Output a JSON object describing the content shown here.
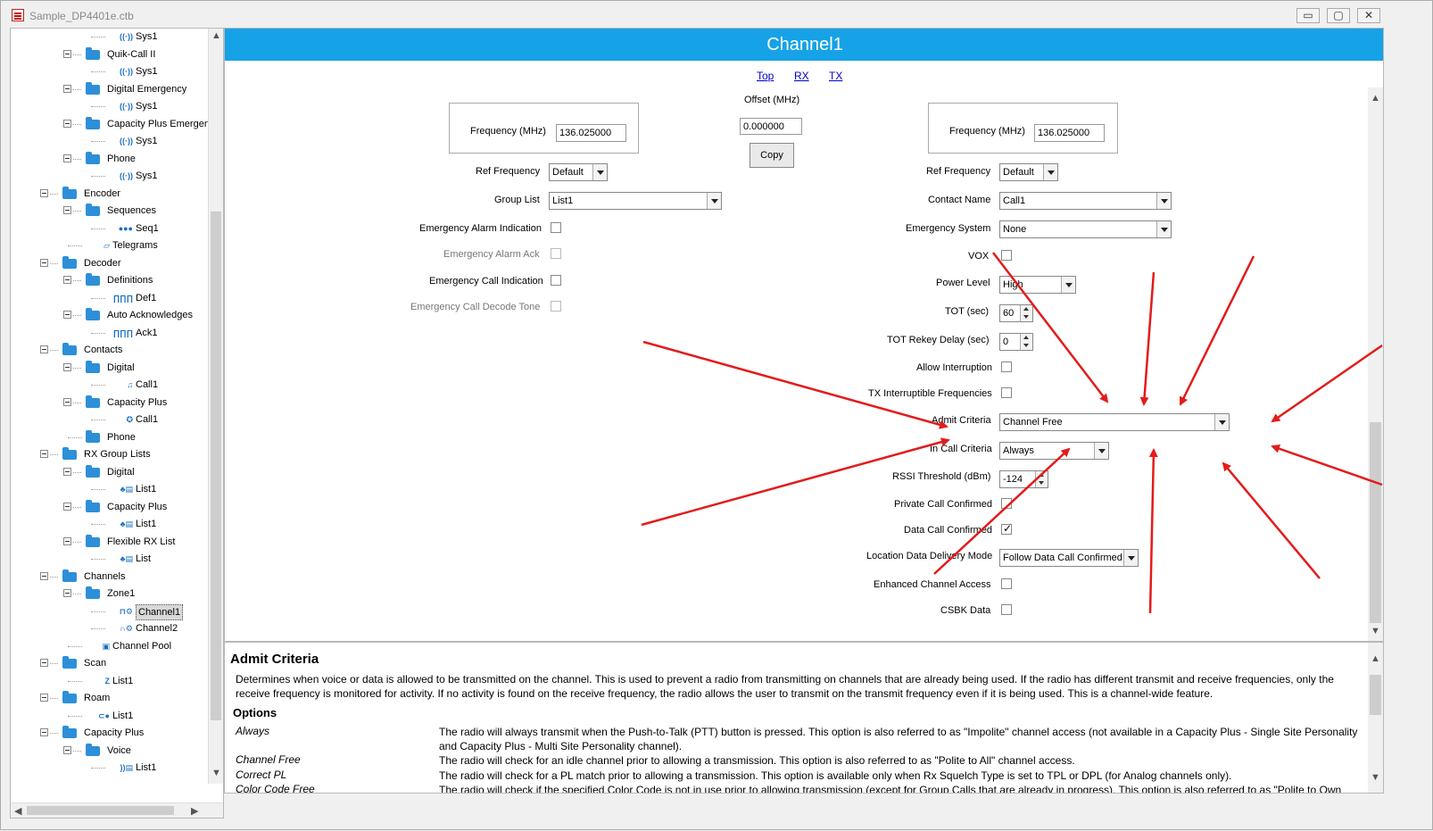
{
  "window": {
    "title": "Sample_DP4401e.ctb",
    "minimize": "▭",
    "maximize": "▢",
    "close": "✕"
  },
  "tree": [
    {
      "label": "Sys1",
      "depth": 3,
      "icon": "antenna-icon",
      "expander": false
    },
    {
      "label": "Quik-Call II",
      "depth": 2,
      "icon": "folder-icon",
      "expander": true
    },
    {
      "label": "Sys1",
      "depth": 3,
      "icon": "antenna-icon",
      "expander": false
    },
    {
      "label": "Digital Emergency",
      "depth": 2,
      "icon": "folder-icon",
      "expander": true
    },
    {
      "label": "Sys1",
      "depth": 3,
      "icon": "antenna-icon",
      "expander": false
    },
    {
      "label": "Capacity Plus Emergen",
      "depth": 2,
      "icon": "folder-icon",
      "expander": true
    },
    {
      "label": "Sys1",
      "depth": 3,
      "icon": "antenna-icon",
      "expander": false
    },
    {
      "label": "Phone",
      "depth": 2,
      "icon": "folder-icon",
      "expander": true
    },
    {
      "label": "Sys1",
      "depth": 3,
      "icon": "antenna-icon",
      "expander": false
    },
    {
      "label": "Encoder",
      "depth": 1,
      "icon": "folder-icon",
      "expander": true
    },
    {
      "label": "Sequences",
      "depth": 2,
      "icon": "folder-icon",
      "expander": true
    },
    {
      "label": "Seq1",
      "depth": 3,
      "icon": "sequence-icon",
      "expander": false
    },
    {
      "label": "Telegrams",
      "depth": 2,
      "icon": "telegram-icon",
      "expander": false
    },
    {
      "label": "Decoder",
      "depth": 1,
      "icon": "folder-icon",
      "expander": true
    },
    {
      "label": "Definitions",
      "depth": 2,
      "icon": "folder-icon",
      "expander": true
    },
    {
      "label": "Def1",
      "depth": 3,
      "icon": "waveform-icon",
      "expander": false
    },
    {
      "label": "Auto Acknowledges",
      "depth": 2,
      "icon": "folder-icon",
      "expander": true
    },
    {
      "label": "Ack1",
      "depth": 3,
      "icon": "waveform-icon",
      "expander": false
    },
    {
      "label": "Contacts",
      "depth": 1,
      "icon": "folder-icon",
      "expander": true
    },
    {
      "label": "Digital",
      "depth": 2,
      "icon": "folder-icon",
      "expander": true
    },
    {
      "label": "Call1",
      "depth": 3,
      "icon": "contact-icon",
      "expander": false
    },
    {
      "label": "Capacity Plus",
      "depth": 2,
      "icon": "folder-icon",
      "expander": true
    },
    {
      "label": "Call1",
      "depth": 3,
      "icon": "contact-group-icon",
      "expander": false
    },
    {
      "label": "Phone",
      "depth": 2,
      "icon": "folder-icon",
      "expander": false
    },
    {
      "label": "RX Group Lists",
      "depth": 1,
      "icon": "folder-icon",
      "expander": true
    },
    {
      "label": "Digital",
      "depth": 2,
      "icon": "folder-icon",
      "expander": true
    },
    {
      "label": "List1",
      "depth": 3,
      "icon": "group-list-icon",
      "expander": false
    },
    {
      "label": "Capacity Plus",
      "depth": 2,
      "icon": "folder-icon",
      "expander": true
    },
    {
      "label": "List1",
      "depth": 3,
      "icon": "group-list-icon",
      "expander": false
    },
    {
      "label": "Flexible RX List",
      "depth": 2,
      "icon": "folder-icon",
      "expander": true
    },
    {
      "label": "List",
      "depth": 3,
      "icon": "group-list-icon",
      "expander": false
    },
    {
      "label": "Channels",
      "depth": 1,
      "icon": "folder-icon",
      "expander": true
    },
    {
      "label": "Zone1",
      "depth": 2,
      "icon": "folder-icon",
      "expander": true
    },
    {
      "label": "Channel1",
      "depth": 3,
      "icon": "digital-channel-icon",
      "expander": false,
      "selected": true
    },
    {
      "label": "Channel2",
      "depth": 3,
      "icon": "analog-channel-icon",
      "expander": false
    },
    {
      "label": "Channel Pool",
      "depth": 2,
      "icon": "cube-icon",
      "expander": false
    },
    {
      "label": "Scan",
      "depth": 1,
      "icon": "folder-icon",
      "expander": true
    },
    {
      "label": "List1",
      "depth": 2,
      "icon": "scan-list-icon",
      "expander": false
    },
    {
      "label": "Roam",
      "depth": 1,
      "icon": "folder-icon",
      "expander": true
    },
    {
      "label": "List1",
      "depth": 2,
      "icon": "roam-list-icon",
      "expander": false
    },
    {
      "label": "Capacity Plus",
      "depth": 1,
      "icon": "folder-icon",
      "expander": true
    },
    {
      "label": "Voice",
      "depth": 2,
      "icon": "folder-icon",
      "expander": true
    },
    {
      "label": "List1",
      "depth": 3,
      "icon": "voice-list-icon",
      "expander": false
    }
  ],
  "main": {
    "header": "Channel1",
    "links": {
      "top": "Top",
      "rx": "RX",
      "tx": "TX"
    },
    "rx": {
      "frequency_label": "Frequency (MHz)",
      "frequency_value": "136.025000",
      "ref_frequency_label": "Ref Frequency",
      "ref_frequency_value": "Default",
      "group_list_label": "Group List",
      "group_list_value": "List1",
      "emergency_alarm_indication_label": "Emergency Alarm Indication",
      "emergency_alarm_ack_label": "Emergency Alarm Ack",
      "emergency_call_indication_label": "Emergency Call Indication",
      "emergency_call_decode_tone_label": "Emergency Call Decode Tone"
    },
    "offset": {
      "label": "Offset (MHz)",
      "value": "0.000000",
      "copy_label": "Copy"
    },
    "tx": {
      "frequency_label": "Frequency (MHz)",
      "frequency_value": "136.025000",
      "ref_frequency_label": "Ref Frequency",
      "ref_frequency_value": "Default",
      "contact_name_label": "Contact Name",
      "contact_name_value": "Call1",
      "emergency_system_label": "Emergency System",
      "emergency_system_value": "None",
      "vox_label": "VOX",
      "power_level_label": "Power Level",
      "power_level_value": "High",
      "tot_label": "TOT (sec)",
      "tot_value": "60",
      "tot_rekey_label": "TOT Rekey Delay (sec)",
      "tot_rekey_value": "0",
      "allow_interruption_label": "Allow Interruption",
      "tx_interruptible_label": "TX Interruptible Frequencies",
      "admit_criteria_label": "Admit Criteria",
      "admit_criteria_value": "Channel Free",
      "in_call_criteria_label": "In Call Criteria",
      "in_call_criteria_value": "Always",
      "rssi_label": "RSSI Threshold (dBm)",
      "rssi_value": "-124",
      "private_call_confirmed_label": "Private Call Confirmed",
      "data_call_confirmed_label": "Data Call Confirmed",
      "location_data_label": "Location Data Delivery Mode",
      "location_data_value": "Follow Data Call Confirmed",
      "enhanced_channel_access_label": "Enhanced Channel Access",
      "csbk_data_label": "CSBK Data"
    }
  },
  "help": {
    "title": "Admit Criteria",
    "description": "Determines when voice or data is allowed to be transmitted on the channel. This is used to prevent a radio from transmitting on channels that are already being used. If the radio has different transmit and receive frequencies, only the receive frequency is monitored for activity. If no activity is found on the receive frequency, the radio allows the user to transmit on the transmit frequency even if it is being used. This is a channel-wide feature.",
    "options_heading": "Options",
    "options": [
      {
        "name": "Always",
        "desc": "The radio will always transmit when the Push-to-Talk (PTT) button is pressed. This option is also referred to as \"Impolite\" channel access (not available in a Capacity Plus - Single Site Personality and Capacity Plus - Multi Site Personality channel)."
      },
      {
        "name": "Channel Free",
        "desc": "The radio will check for an idle channel prior to allowing a transmission. This option is also referred to as \"Polite to All\" channel access."
      },
      {
        "name": "Correct PL",
        "desc": "The radio will check for a PL match prior to allowing a transmission. This option is available only when Rx Squelch Type is set to TPL or DPL  (for Analog channels only)."
      },
      {
        "name": "Color Code Free",
        "desc": "The radio will check if the specified Color Code is not in use prior to allowing transmission (except for Group Calls that are already in progress). This option is also referred to as \"Polite to Own"
      }
    ]
  },
  "colors": {
    "header": "#16a2e6",
    "arrow": "#e31b1b",
    "link": "#0000cc"
  }
}
